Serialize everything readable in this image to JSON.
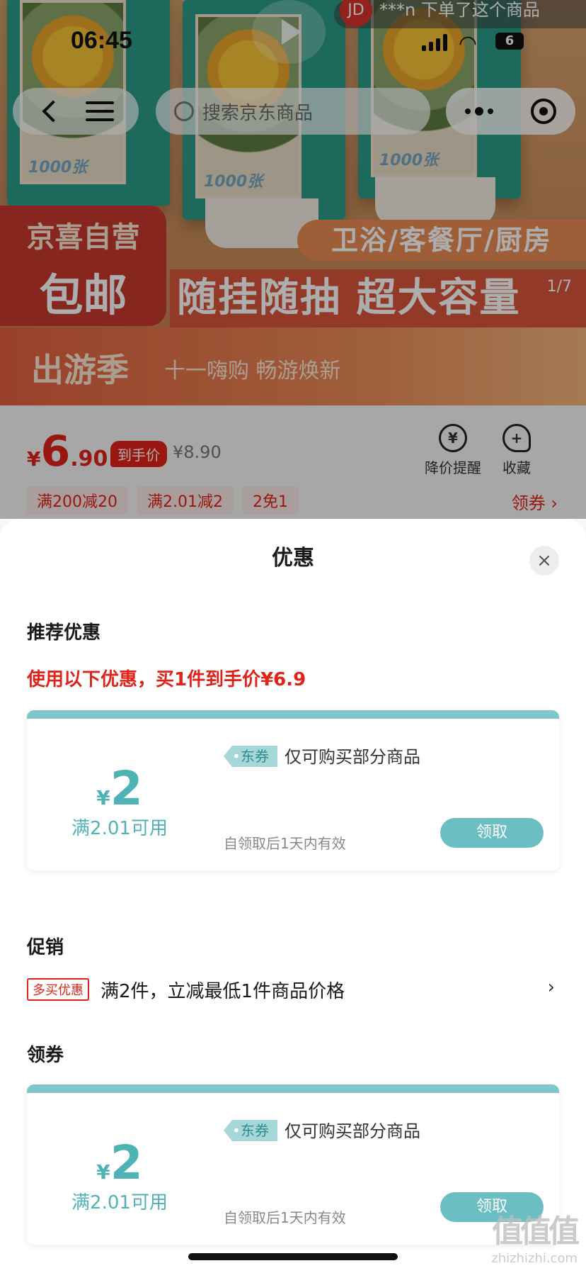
{
  "status_bar": {
    "time": "06:45",
    "battery": "6"
  },
  "live_notice": {
    "avatar": "JD",
    "text": "***n  下单了这个商品"
  },
  "nav": {
    "search_placeholder": "搜索京东商品"
  },
  "banner": {
    "box_count": "1000张",
    "badge_line1": "京喜自营",
    "badge_line2": "包邮",
    "rooms": "卫浴/客餐厅/厨房",
    "headline": "随挂随抽 超大容量",
    "event_title": "出游季",
    "event_sub": "十一嗨购 畅游焕新",
    "page_indicator": "1/7"
  },
  "price": {
    "yen": "¥",
    "integer": "6",
    "decimal": ".90",
    "daoshou_label": "到手价",
    "original": "¥8.90",
    "price_alert_label": "降价提醒",
    "favorite_label": "收藏",
    "tags": [
      "满200减20",
      "满2.01减2",
      "2免1"
    ],
    "coupon_link": "领券 ›"
  },
  "sheet": {
    "title": "优惠",
    "close": "×",
    "recommended_heading": "推荐优惠",
    "recommended_note": "使用以下优惠，买1件到手价¥6.9",
    "promotion_heading": "促销",
    "promotion_badge": "多买优惠",
    "promotion_text": "满2件，立减最低1件商品价格",
    "promotion_arrow": "›",
    "coupon_heading": "领券"
  },
  "coupons": [
    {
      "yen": "¥",
      "amount": "2",
      "condition": "满2.01可用",
      "tag": "东券",
      "desc": "仅可购买部分商品",
      "validity": "自领取后1天内有效",
      "button": "领取"
    },
    {
      "yen": "¥",
      "amount": "2",
      "condition": "满2.01可用",
      "tag": "东券",
      "desc": "仅可购买部分商品",
      "validity": "自领取后1天内有效",
      "button": "领取"
    }
  ],
  "watermark": {
    "line1": "值值值",
    "line2": "zhizhizhi.com"
  },
  "colors": {
    "accent_red": "#e2231a",
    "coupon_teal": "#6bbec1",
    "banner_green": "#2b9c88"
  }
}
